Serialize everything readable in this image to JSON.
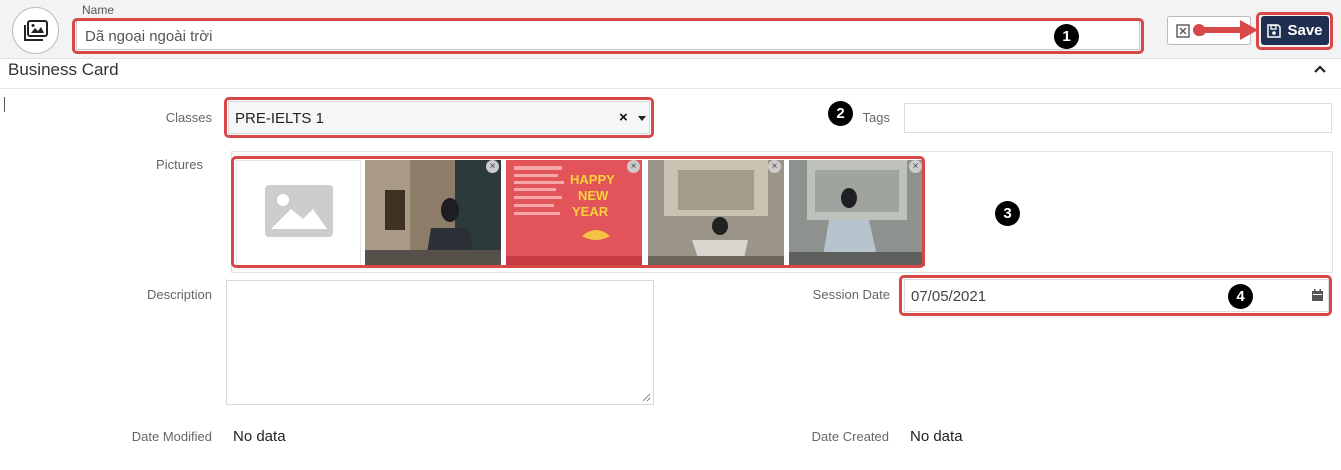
{
  "header": {
    "name_label": "Name",
    "name_value": "Dã ngoại ngoài trời",
    "save_label": "Save",
    "discard_label": "D"
  },
  "section": {
    "title": "Business Card"
  },
  "fields": {
    "classes": {
      "label": "Classes",
      "value": "PRE-IELTS 1"
    },
    "tags": {
      "label": "Tags",
      "value": ""
    },
    "pictures": {
      "label": "Pictures",
      "items": [
        {
          "kind": "placeholder"
        },
        {
          "kind": "photo",
          "caption": ""
        },
        {
          "kind": "poster",
          "text": "HAPPY NEW YEAR"
        },
        {
          "kind": "photo",
          "caption": ""
        },
        {
          "kind": "photo",
          "caption": ""
        }
      ]
    },
    "description": {
      "label": "Description",
      "value": ""
    },
    "session_date": {
      "label": "Session Date",
      "value": "07/05/2021"
    },
    "date_modified": {
      "label": "Date Modified",
      "value": "No data"
    },
    "date_created": {
      "label": "Date Created",
      "value": "No data"
    }
  },
  "annotations": [
    "1",
    "2",
    "3",
    "4"
  ],
  "colors": {
    "highlight": "#d94848",
    "save_button": "#1f2f4f"
  }
}
